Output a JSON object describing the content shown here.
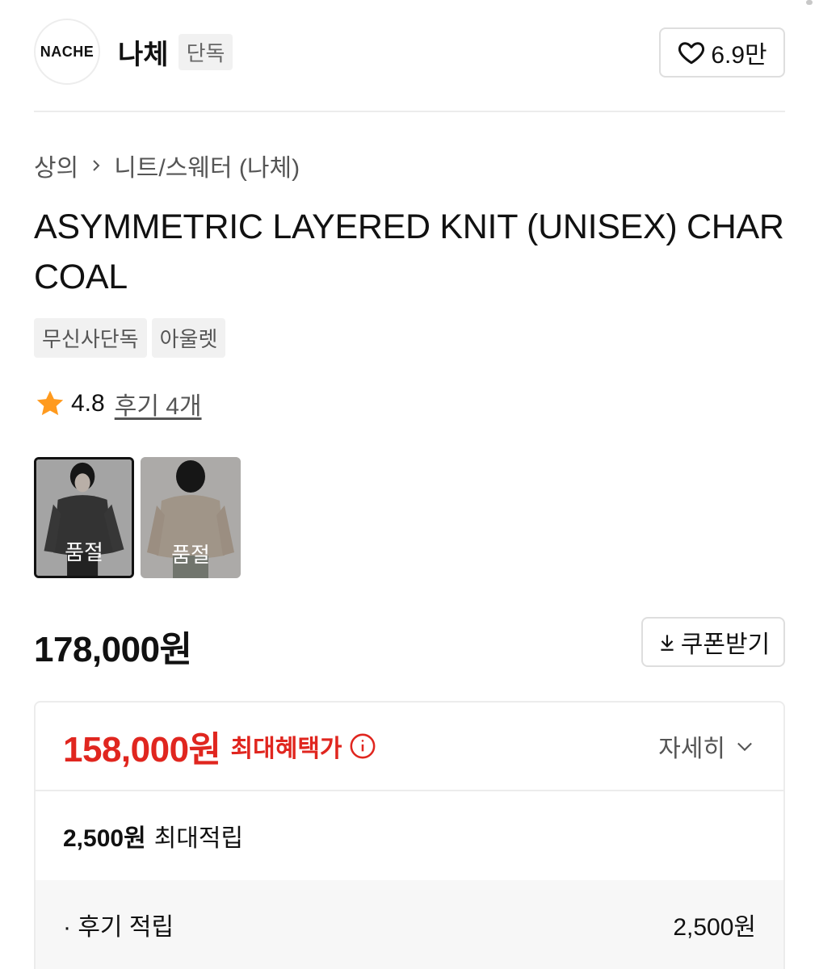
{
  "brand": {
    "logo_text": "NACHE",
    "name": "나체",
    "badge": "단독",
    "like_count": "6.9만"
  },
  "breadcrumb": {
    "level1": "상의",
    "level2": "니트/스웨터 (나체)"
  },
  "product": {
    "title": "ASYMMETRIC LAYERED KNIT (UNISEX) CHARCOAL",
    "tags": [
      "무신사단독",
      "아울렛"
    ],
    "rating": "4.8",
    "reviews": "후기 4개",
    "price": "178,000원"
  },
  "swatches": [
    {
      "label": "품절",
      "color": "#4a4a4a"
    },
    {
      "label": "품절",
      "color": "#cfc6bb"
    }
  ],
  "coupon": {
    "label": "쿠폰받기"
  },
  "benefit": {
    "max_price": "158,000원",
    "max_label": "최대혜택가",
    "detail_label": "자세히",
    "points_amount": "2,500원",
    "points_label": "최대적립",
    "review_points_label": "· 후기 적립",
    "review_points_amount": "2,500원"
  },
  "colors": {
    "accent_red": "#e0261f",
    "star": "#ff9a1e"
  }
}
